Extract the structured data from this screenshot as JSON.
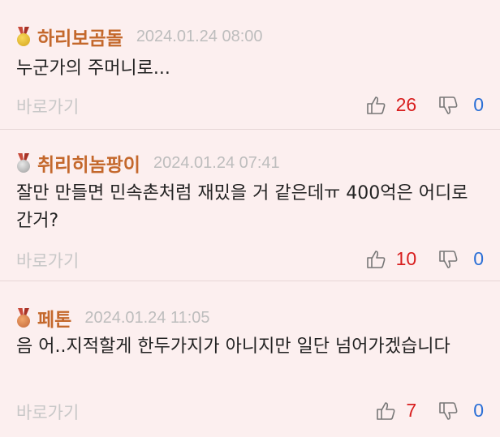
{
  "comments": [
    {
      "author": "하리보곰돌",
      "medal": "gold-medal-icon",
      "timestamp": "2024.01.24 08:00",
      "text": "누군가의 주머니로...",
      "shortcut": "바로가기",
      "upvotes": "26",
      "downvotes": "0"
    },
    {
      "author": "취리히놈팡이",
      "medal": "silver-medal-icon",
      "timestamp": "2024.01.24 07:41",
      "text": "잘만 만들면 민속촌처럼 재밌을 거 같은데ㅠ 400억은 어디로 간거?",
      "shortcut": "바로가기",
      "upvotes": "10",
      "downvotes": "0"
    },
    {
      "author": "페톤",
      "medal": "bronze-medal-icon",
      "timestamp": "2024.01.24 11:05",
      "text": "음 어..지적할게 한두가지가 아니지만 일단 넘어가겠습니다",
      "shortcut": "바로가기",
      "upvotes": "7",
      "downvotes": "0"
    }
  ],
  "colors": {
    "background": "#fcefef",
    "author": "#c4682c",
    "timestamp": "#bdbdbd",
    "upvote": "#d81e1e",
    "downvote": "#2a6fd6"
  }
}
